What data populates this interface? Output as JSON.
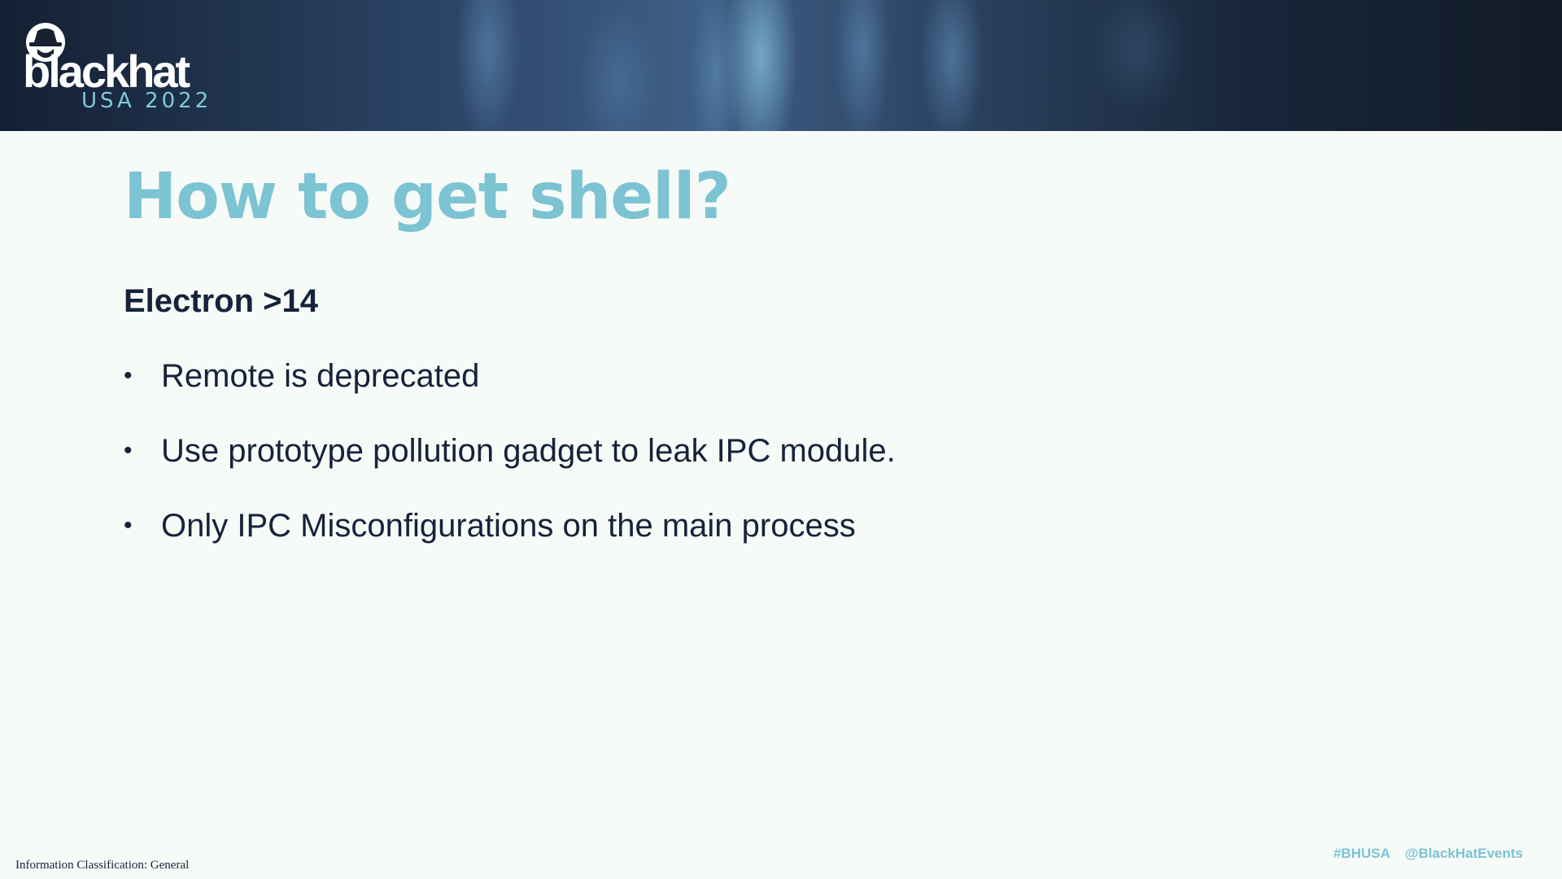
{
  "header": {
    "logo_word": "blackhat",
    "logo_event": "USA 2022",
    "logo_mark": "hat-spy-icon"
  },
  "slide": {
    "title": "How to get shell?",
    "subheading": "Electron >14",
    "bullets": [
      "Remote is deprecated",
      "Use prototype pollution gadget to leak IPC module.",
      "Only IPC Misconfigurations on the main process"
    ]
  },
  "footer": {
    "classification": "Information Classification: General",
    "hashtag": "#BHUSA",
    "handle": "@BlackHatEvents"
  },
  "colors": {
    "header_bg": "#16202e",
    "title_accent": "#7cc3d3",
    "body_text": "#16233a",
    "background": "#f6fbf8"
  }
}
